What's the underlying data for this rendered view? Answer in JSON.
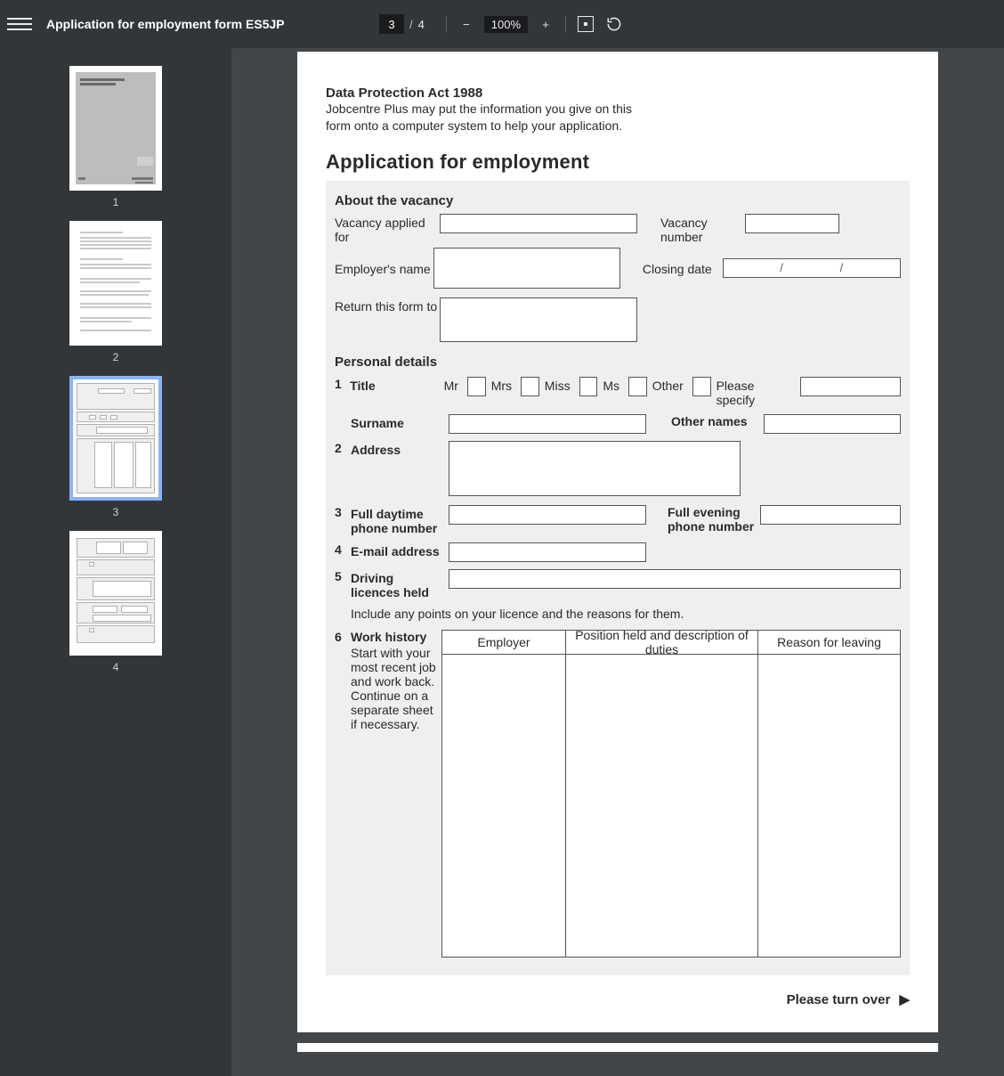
{
  "toolbar": {
    "title": "Application for employment form ES5JP",
    "page_current": "3",
    "page_total": "4",
    "page_sep": "/",
    "zoom_minus": "−",
    "zoom_value": "100%",
    "zoom_plus": "+"
  },
  "sidebar": {
    "thumbs": [
      "1",
      "2",
      "3",
      "4"
    ],
    "selected_index": 2
  },
  "doc": {
    "dp_title": "Data Protection Act 1988",
    "dp_text1": "Jobcentre Plus may put the information you give on this",
    "dp_text2": "form onto a computer system to help your application.",
    "app_title": "Application for employment",
    "sec_vacancy": "About the vacancy",
    "vacancy_applied": "Vacancy applied for",
    "vacancy_number": "Vacancy number",
    "employer_name": "Employer's name",
    "closing_date": "Closing date",
    "closing_slash": "/",
    "return_form": "Return this form to",
    "sec_personal": "Personal details",
    "q1_num": "1",
    "q1_label": "Title",
    "title_mr": "Mr",
    "title_mrs": "Mrs",
    "title_miss": "Miss",
    "title_ms": "Ms",
    "title_other": "Other",
    "title_specify": "Please specify",
    "surname": "Surname",
    "other_names": "Other names",
    "q2_num": "2",
    "q2_label": "Address",
    "q3_num": "3",
    "q3_label": "Full daytime phone number",
    "q3b_label": "Full evening phone number",
    "q4_num": "4",
    "q4_label": "E-mail address",
    "q5_num": "5",
    "q5_label": "Driving licences held",
    "q5_hint": "Include any points on your licence and the reasons for them.",
    "q6_num": "6",
    "q6_label": "Work history",
    "q6_hint": "Start with your most recent job and work back. Continue on a separate sheet if necessary.",
    "wh_col1": "Employer",
    "wh_col2": "Position held and description of duties",
    "wh_col3": "Reason for leaving",
    "turn_over": "Please turn over",
    "tri": "▶"
  }
}
